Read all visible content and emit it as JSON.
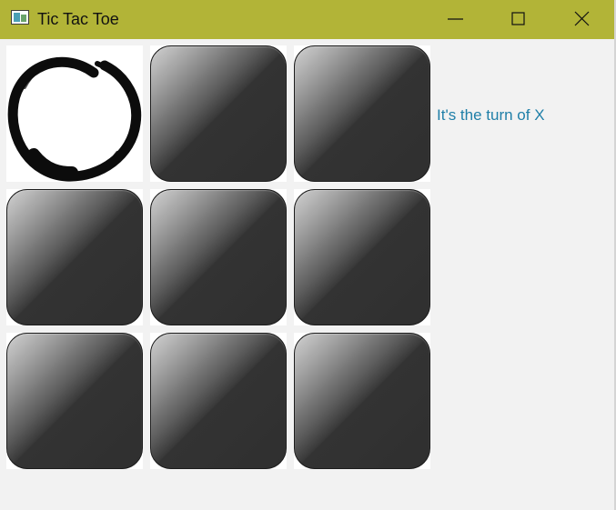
{
  "window": {
    "title": "Tic Tac Toe",
    "icon": "app-window-icon",
    "controls": [
      "minimize-icon",
      "maximize-icon",
      "close-icon"
    ],
    "titlebar_color": "#b2b437"
  },
  "board": {
    "cells": [
      {
        "row": 1,
        "col": 1,
        "mark": "O"
      },
      {
        "row": 1,
        "col": 2,
        "mark": ""
      },
      {
        "row": 1,
        "col": 3,
        "mark": ""
      },
      {
        "row": 2,
        "col": 1,
        "mark": ""
      },
      {
        "row": 2,
        "col": 2,
        "mark": ""
      },
      {
        "row": 2,
        "col": 3,
        "mark": ""
      },
      {
        "row": 3,
        "col": 1,
        "mark": ""
      },
      {
        "row": 3,
        "col": 2,
        "mark": ""
      },
      {
        "row": 3,
        "col": 3,
        "mark": ""
      }
    ],
    "o_mark_style": "ink-brush-circle",
    "empty_tile_style": "glossy-dark-button"
  },
  "status": {
    "text": "It's the turn of X",
    "color": "#1f7fa8"
  }
}
